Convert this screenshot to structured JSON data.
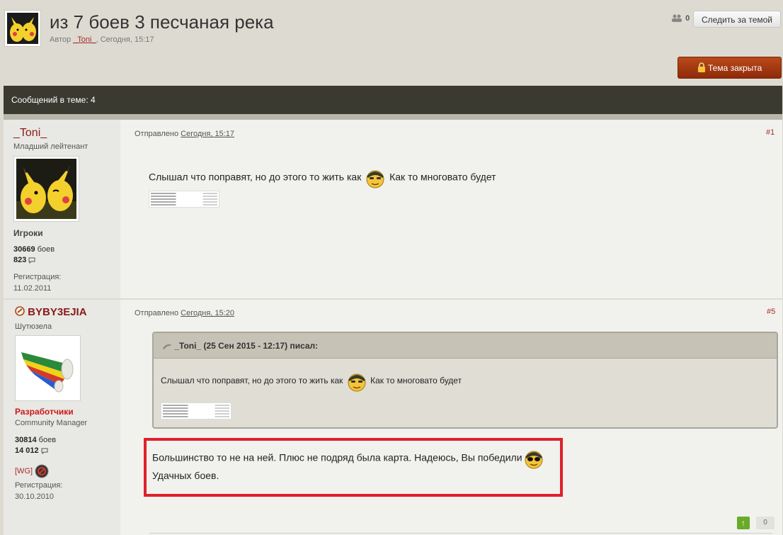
{
  "topic": {
    "title": "из 7 боев 3 песчаная река",
    "meta_prefix": "Автор",
    "author": "_Toni_",
    "meta_suffix": ", Сегодня, 15:17",
    "followers_count": "0",
    "follow_label": "Следить за темой",
    "closed_label": "Тема закрыта",
    "posts_count_label": "Сообщений в теме: 4"
  },
  "posts": [
    {
      "username": "_Toni_",
      "rank": "Младший лейтенант",
      "group": "Игроки",
      "battles_num": "30669",
      "battles_label": "боев",
      "messages": "823",
      "reg_label": "Регистрация:",
      "reg_date": "11.02.2011",
      "posted_label": "Отправлено",
      "posted_time": "Сегодня, 15:17",
      "number": "#1",
      "text_before": "Слышал что поправят, но до этого то жить как",
      "text_after": "Как то многовато будет"
    },
    {
      "username": "BYBY3EJIA",
      "rank": "Шутюзела",
      "group": "Разработчики",
      "group_sub": "Community Manager",
      "battles_num": "30814",
      "battles_label": "боев",
      "messages": "14 012",
      "clan": "[WG]",
      "reg_label": "Регистрация:",
      "reg_date": "30.10.2010",
      "posted_label": "Отправлено",
      "posted_time": "Сегодня, 15:20",
      "number": "#5",
      "quote_header": "_Toni_ (25 Сен 2015 - 12:17) писал:",
      "quote_before": "Слышал что поправят, но до этого то жить как",
      "quote_after": "Как то многовато будет",
      "line1": "Большинство то не на ней. Плюс не подряд была карта. Надеюсь, Вы победили",
      "line2": "Удачных боев.",
      "vote_count": "0"
    }
  ],
  "colors": {
    "accent": "#8b1a1a",
    "bar": "#3a3a31",
    "highlight": "#e0202a",
    "closed": "#a8380f"
  }
}
